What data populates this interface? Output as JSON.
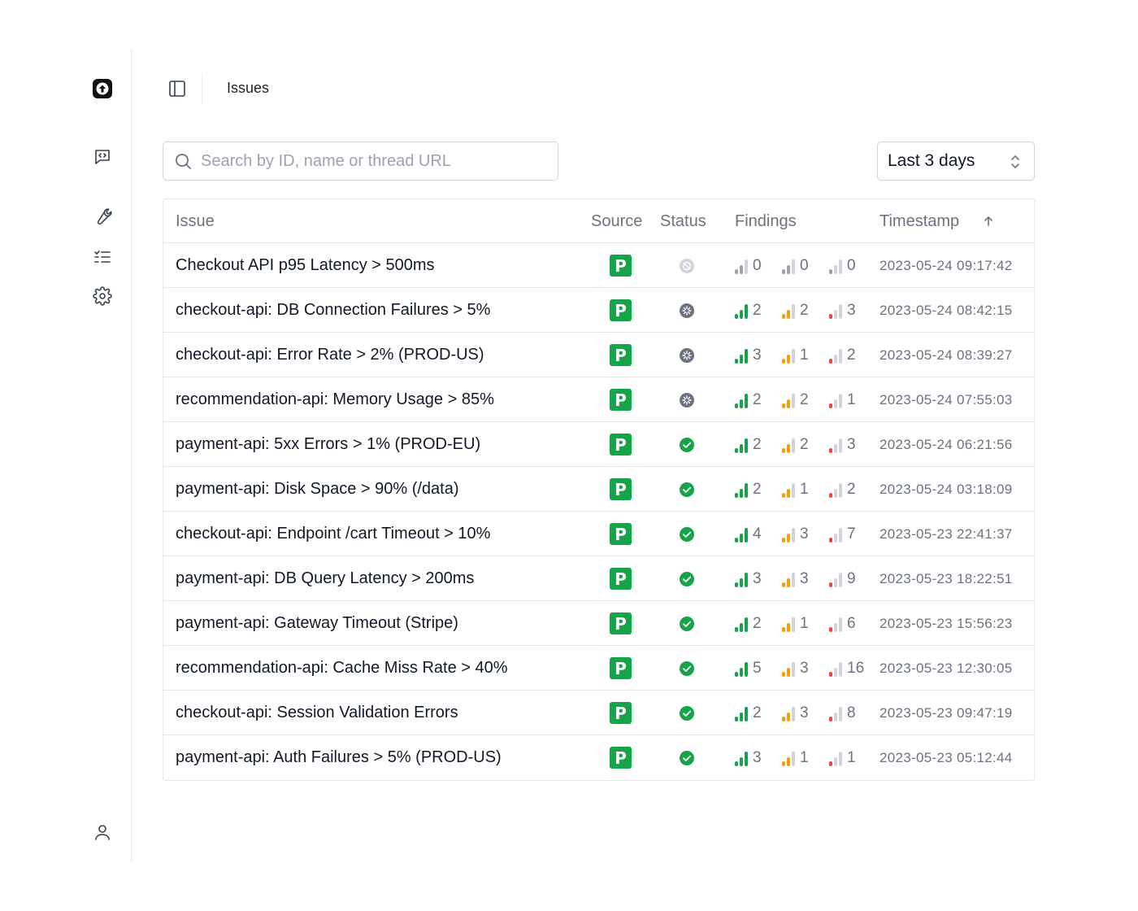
{
  "header": {
    "title": "Issues"
  },
  "search": {
    "placeholder": "Search by ID, name or thread URL"
  },
  "range": {
    "label": "Last 3 days"
  },
  "columns": {
    "issue": "Issue",
    "source": "Source",
    "status": "Status",
    "findings": "Findings",
    "timestamp": "Timestamp"
  },
  "source_badge": "P",
  "colors": {
    "green": "#16a34a",
    "orange": "#f59e0b",
    "red": "#ef4444",
    "inactive": "#d1d5db",
    "muted": "#9ca3af",
    "status_running": "#6b7280",
    "status_done": "#16a34a",
    "status_pending": "#d1d5db"
  },
  "rows": [
    {
      "name": "Checkout API p95 Latency > 500ms",
      "status": "pending",
      "high": "0",
      "medium": "0",
      "low": "0",
      "timestamp": "2023-05-24 09:17:42"
    },
    {
      "name": "checkout-api: DB Connection Failures > 5%",
      "status": "running",
      "high": "2",
      "medium": "2",
      "low": "3",
      "timestamp": "2023-05-24 08:42:15"
    },
    {
      "name": "checkout-api: Error Rate > 2% (PROD-US)",
      "status": "running",
      "high": "3",
      "medium": "1",
      "low": "2",
      "timestamp": "2023-05-24 08:39:27"
    },
    {
      "name": "recommendation-api: Memory Usage > 85%",
      "status": "running",
      "high": "2",
      "medium": "2",
      "low": "1",
      "timestamp": "2023-05-24 07:55:03"
    },
    {
      "name": "payment-api: 5xx Errors > 1% (PROD-EU)",
      "status": "done",
      "high": "2",
      "medium": "2",
      "low": "3",
      "timestamp": "2023-05-24 06:21:56"
    },
    {
      "name": "payment-api: Disk Space > 90% (/data)",
      "status": "done",
      "high": "2",
      "medium": "1",
      "low": "2",
      "timestamp": "2023-05-24 03:18:09"
    },
    {
      "name": "checkout-api: Endpoint /cart Timeout > 10%",
      "status": "done",
      "high": "4",
      "medium": "3",
      "low": "7",
      "timestamp": "2023-05-23 22:41:37"
    },
    {
      "name": "payment-api: DB Query Latency > 200ms",
      "status": "done",
      "high": "3",
      "medium": "3",
      "low": "9",
      "timestamp": "2023-05-23 18:22:51"
    },
    {
      "name": "payment-api: Gateway Timeout (Stripe)",
      "status": "done",
      "high": "2",
      "medium": "1",
      "low": "6",
      "timestamp": "2023-05-23 15:56:23"
    },
    {
      "name": "recommendation-api: Cache Miss Rate > 40%",
      "status": "done",
      "high": "5",
      "medium": "3",
      "low": "16",
      "timestamp": "2023-05-23 12:30:05"
    },
    {
      "name": "checkout-api: Session Validation Errors",
      "status": "done",
      "high": "2",
      "medium": "3",
      "low": "8",
      "timestamp": "2023-05-23 09:47:19"
    },
    {
      "name": "payment-api: Auth Failures > 5% (PROD-US)",
      "status": "done",
      "high": "3",
      "medium": "1",
      "low": "1",
      "timestamp": "2023-05-23 05:12:44"
    }
  ]
}
